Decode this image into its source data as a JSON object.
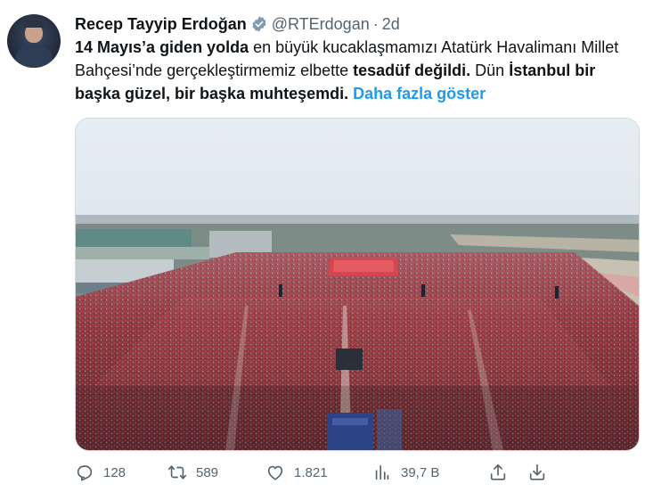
{
  "author": {
    "name": "Recep Tayyip Erdoğan",
    "handle": "@RTErdogan",
    "separator": "·",
    "time": "2d",
    "verified": true
  },
  "tweet": {
    "part1_bold": "14 Mayıs’a giden yolda",
    "part2": " en büyük kucaklaşmamızı Atatürk Havalimanı Millet Bahçesi’nde gerçekleştirmemiz elbette ",
    "part3_bold": "tesadüf değildi.",
    "part4": " Dün ",
    "part5_bold": "İstanbul bir başka güzel, bir başka muhteşemdi.",
    "show_more": "Daha fazla göster"
  },
  "actions": {
    "reply_count": "128",
    "retweet_count": "589",
    "like_count": "1.821",
    "views_count": "39,7 B"
  },
  "icons": [
    "verified-badge-icon",
    "reply-icon",
    "retweet-icon",
    "like-icon",
    "views-icon",
    "share-icon",
    "download-icon"
  ],
  "colors": {
    "accent": "#1d9bf0",
    "text": "#0f1419",
    "muted": "#536471"
  }
}
